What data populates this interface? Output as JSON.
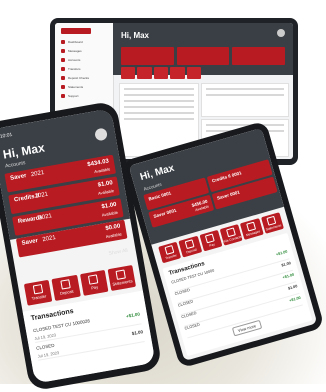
{
  "greeting": "Hi, Max",
  "accounts_label": "Accounts",
  "status_time": "10:01",
  "phone": {
    "accounts": [
      {
        "name": "Saver",
        "number": "2021",
        "balance": "$434.03",
        "available": "Available"
      },
      {
        "name": "Credits Il",
        "number": "2021",
        "balance": "$1.00",
        "available": "Available"
      },
      {
        "name": "Rewards",
        "number": "2021",
        "balance": "$1.00",
        "available": "Available"
      },
      {
        "name": "Saver",
        "number": "2021",
        "balance": "$0.00",
        "available": "Available"
      }
    ],
    "show_all": "Show All",
    "actions": [
      "Transfer",
      "Deposit",
      "Pay",
      "Statements"
    ],
    "transactions_title": "Transactions",
    "transactions": [
      {
        "desc": "CLOSED TEST CU 1000026",
        "date": "Jul 19, 2023",
        "amount": "+$1.00",
        "positive": true
      },
      {
        "desc": "CLOSED",
        "date": "Jul 19, 2023",
        "amount": "$1.00",
        "positive": false
      }
    ]
  },
  "tablet": {
    "accounts": [
      {
        "name": "Basic 0001",
        "number": "",
        "balance": "",
        "available": ""
      },
      {
        "name": "Saver 0001",
        "number": "",
        "balance": "$456.00",
        "available": "Available"
      },
      {
        "name": "Credits Il 0001",
        "number": "",
        "balance": "",
        "available": ""
      },
      {
        "name": "Saver 0001",
        "number": "",
        "balance": "",
        "available": ""
      }
    ],
    "actions": [
      "Transfer",
      "Deposit",
      "Pay",
      "File Contacts",
      "Messages",
      "Statements"
    ],
    "transactions_title": "Transactions",
    "transactions": [
      {
        "desc": "CLOSED TEST CU 10000",
        "amount": "+$1.00",
        "positive": true
      },
      {
        "desc": "CLOSED",
        "amount": "$1.00",
        "positive": false
      },
      {
        "desc": "CLOSED",
        "amount": "+$1.00",
        "positive": true
      },
      {
        "desc": "CLOSED",
        "amount": "$1.00",
        "positive": false
      },
      {
        "desc": "CLOSED",
        "amount": "+$1.00",
        "positive": true
      }
    ],
    "view_more": "View more"
  },
  "desktop": {
    "sidebar": [
      "Dashboard",
      "Messages",
      "Accounts",
      "Transfers",
      "Deposit Checks",
      "Statements",
      "Support"
    ],
    "panels": [
      "Transactions",
      "Messages",
      "Services"
    ]
  },
  "colors": {
    "brand_red": "#b81c22",
    "header_dark": "#3b4046",
    "positive_green": "#2e8b3a"
  }
}
